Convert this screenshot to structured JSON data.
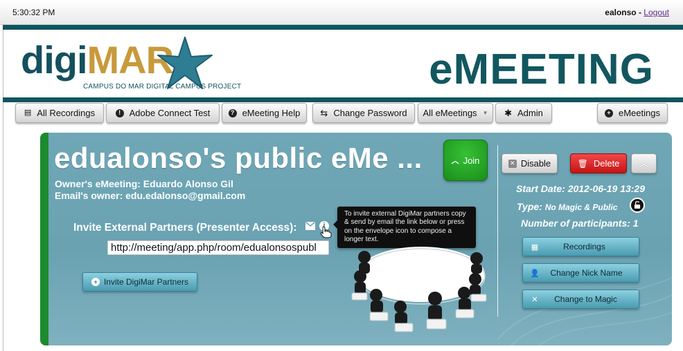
{
  "topbar": {
    "time": "5:30:32 PM",
    "username": "ealonso",
    "separator": " - ",
    "logout": "Logout"
  },
  "logo": {
    "digi": "digi",
    "mar": "MAR",
    "subtitle": "CAMPUS DO MAR DIGITAL CAMPUS PROJECT"
  },
  "brand": "eMEETING",
  "nav": {
    "all_recordings": "All Recordings",
    "adobe_test": "Adobe Connect Test",
    "help": "eMeeting Help",
    "change_password": "Change Password",
    "all_emeetings": "All eMeetings",
    "admin": "Admin",
    "emeetings": "eMeetings"
  },
  "meeting": {
    "title": "edualonso's public eMe ...",
    "owner_line": "Owner's eMeeting: Eduardo Alonso Gil",
    "email_line": "Email's owner: edu.edalonso@gmail.com",
    "join": "Join",
    "invite_label": "Invite External Partners (Presenter Access):",
    "link": "http://meeting/app.php/room/edualonsospubl",
    "tooltip": "To invite external DigiMar partners copy & send by email the link below or press on the envelope icon to compose a longer text.",
    "invite_button": "Invite DigiMar Partners"
  },
  "actions": {
    "disable": "Disable",
    "delete": "Delete"
  },
  "details": {
    "start_date_label": "Start Date:",
    "start_date_value": "2012-06-19 13:29",
    "type_label": "Type:",
    "type_value": "No Magic & Public",
    "participants_label": "Number of participants:",
    "participants_value": "1"
  },
  "side_buttons": {
    "recordings": "Recordings",
    "change_nick": "Change Nick Name",
    "change_magic": "Change to Magic"
  },
  "icons": {
    "recordings": "list-icon",
    "adobe": "exclamation-icon",
    "help": "question-icon",
    "password": "refresh-icon",
    "admin": "gear-icon",
    "emeetings": "plus-icon",
    "join": "chevron-up-icon",
    "disable": "x-icon",
    "delete": "trash-icon",
    "collapse": "chevron-up-icon",
    "envelope": "envelope-icon",
    "info": "info-icon",
    "lock": "lock-icon",
    "film": "film-icon",
    "user": "user-icon",
    "magic": "x-icon"
  },
  "colors": {
    "teal_dark": "#0e5560",
    "panel": "#6fa7b6",
    "join_green": "#1b8d1b",
    "delete_red": "#c71414",
    "logo_gold": "#c79a3b"
  }
}
